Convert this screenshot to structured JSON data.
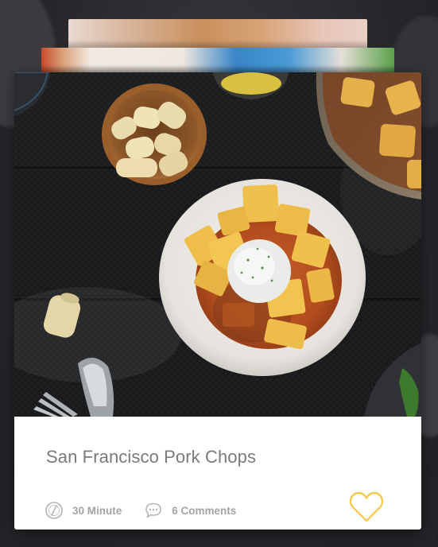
{
  "recipe": {
    "title": "San Francisco Pork Chops",
    "time_label": "30 Minute",
    "comments_label": "6 Comments",
    "favorited": false
  },
  "icons": {
    "time": "clock-icon",
    "comments": "comment-bubble-icon",
    "favorite": "heart-icon"
  },
  "colors": {
    "accent": "#f6c744",
    "title_text": "#7a7a7a",
    "meta_text": "#a3a3a3",
    "background": "#2a2b2e"
  }
}
